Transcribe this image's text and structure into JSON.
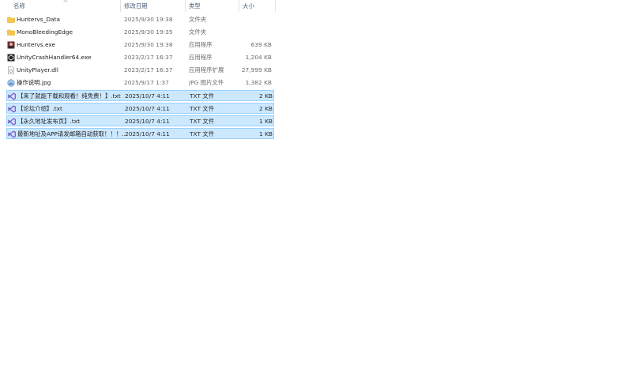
{
  "columns": {
    "name": "名称",
    "date": "修改日期",
    "type": "类型",
    "size": "大小"
  },
  "files": [
    {
      "name": "Huntervs_Data",
      "date": "2025/9/30 19:38",
      "type": "文件夹",
      "size": "",
      "icon": "folder-icon",
      "selected": false
    },
    {
      "name": "MonoBleedingEdge",
      "date": "2025/9/30 19:35",
      "type": "文件夹",
      "size": "",
      "icon": "folder-icon",
      "selected": false
    },
    {
      "name": "Huntervs.exe",
      "date": "2025/9/30 19:38",
      "type": "应用程序",
      "size": "639 KB",
      "icon": "game-exe-icon",
      "selected": false
    },
    {
      "name": "UnityCrashHandler64.exe",
      "date": "2023/2/17 16:37",
      "type": "应用程序",
      "size": "1,204 KB",
      "icon": "unity-exe-icon",
      "selected": false
    },
    {
      "name": "UnityPlayer.dll",
      "date": "2023/2/17 16:37",
      "type": "应用程序扩展",
      "size": "27,999 KB",
      "icon": "dll-file-icon",
      "selected": false
    },
    {
      "name": "操作说明.jpg",
      "date": "2025/9/17 1:37",
      "type": "JPG 图片文件",
      "size": "1,382 KB",
      "icon": "image-file-icon",
      "selected": false
    },
    {
      "name": "【来了就能下载和观看！纯免费！】.txt",
      "date": "2025/10/7 4:11",
      "type": "TXT 文件",
      "size": "2 KB",
      "icon": "visual-studio-text-icon",
      "selected": true
    },
    {
      "name": "【论坛介绍】.txt",
      "date": "2025/10/7 4:11",
      "type": "TXT 文件",
      "size": "2 KB",
      "icon": "visual-studio-text-icon",
      "selected": true
    },
    {
      "name": "【永久地址发布页】.txt",
      "date": "2025/10/7 4:11",
      "type": "TXT 文件",
      "size": "1 KB",
      "icon": "visual-studio-text-icon",
      "selected": true
    },
    {
      "name": "最新地址及APP请发邮箱自动获取！！！...",
      "date": "2025/10/7 4:11",
      "type": "TXT 文件",
      "size": "1 KB",
      "icon": "visual-studio-text-icon",
      "selected": true
    }
  ],
  "colors": {
    "selection_bg": "#cce8ff",
    "selection_border": "#99d1ff",
    "header_text": "#4c607a",
    "folder": "#f8c649",
    "vs_purple": "#7b4fc9"
  }
}
